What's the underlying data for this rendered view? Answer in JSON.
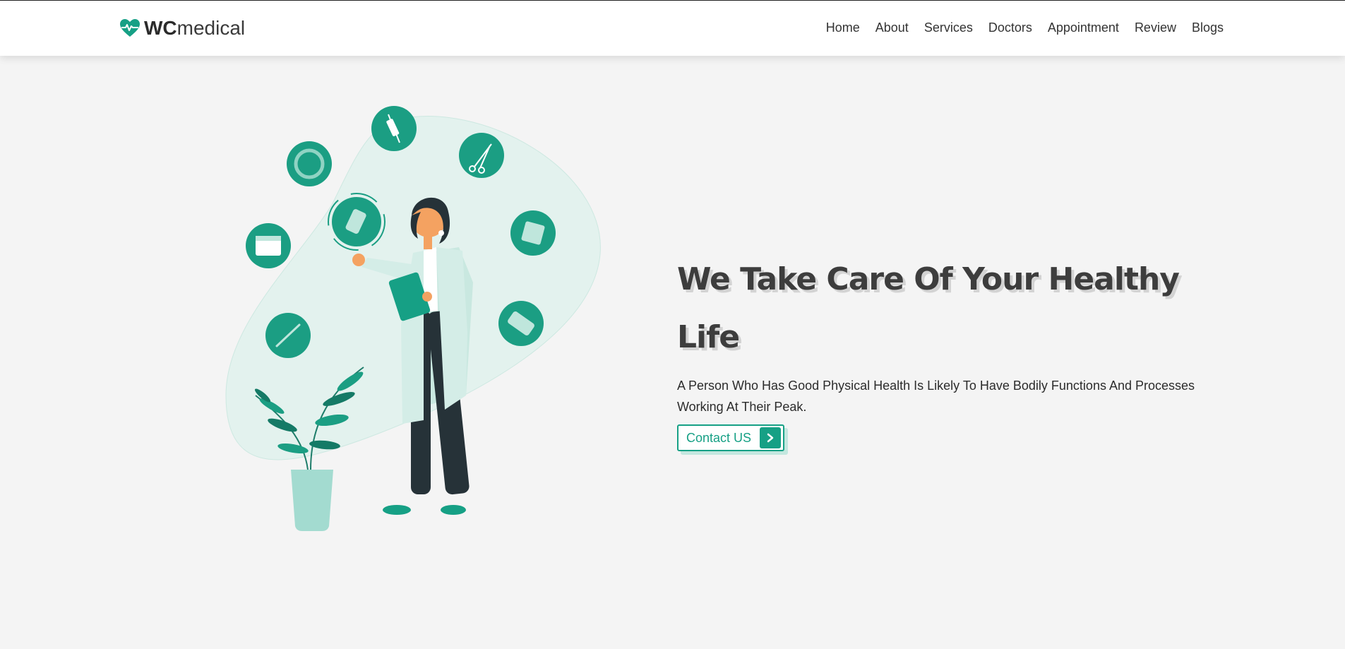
{
  "brand": {
    "bold": "WC",
    "light": "medical",
    "icon": "heart-pulse-icon"
  },
  "nav": {
    "items": [
      "Home",
      "About",
      "Services",
      "Doctors",
      "Appointment",
      "Review",
      "Blogs"
    ]
  },
  "hero": {
    "title_line1": "We Take Care Of Your Healthy",
    "title_line2": "Life",
    "description": "A Person Who Has Good Physical Health Is Likely To Have Bodily Functions And Processes Working At Their Peak.",
    "button_label": "Contact US",
    "button_icon": "chevron-right-icon"
  },
  "colors": {
    "accent": "#16a085",
    "background": "#f4f4f4",
    "header_bg": "#ffffff",
    "title": "#3d3d3d"
  }
}
